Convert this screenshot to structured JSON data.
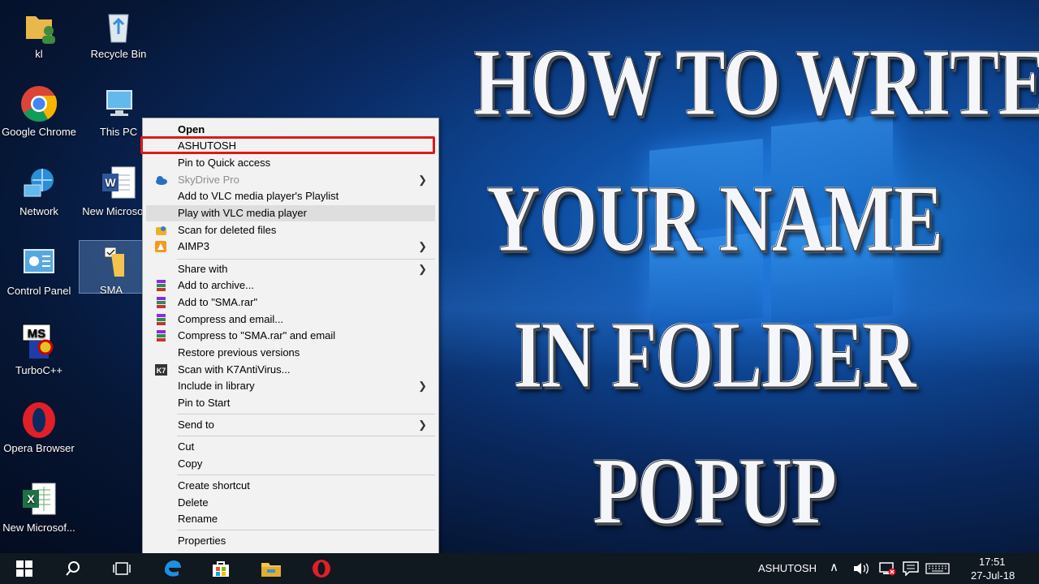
{
  "desktop": {
    "icons": [
      {
        "label": "kl",
        "icon": "user-folder-icon"
      },
      {
        "label": "Recycle Bin",
        "icon": "recycle-bin-icon"
      },
      {
        "label": "Google Chrome",
        "icon": "chrome-icon"
      },
      {
        "label": "This PC",
        "icon": "computer-icon"
      },
      {
        "label": "Network",
        "icon": "network-icon"
      },
      {
        "label": "New Microsof...",
        "icon": "word-doc-icon"
      },
      {
        "label": "Control Panel",
        "icon": "control-panel-icon"
      },
      {
        "label": "SMA",
        "icon": "folder-icon"
      },
      {
        "label": "TurboC++",
        "icon": "turboc-icon"
      },
      {
        "label": "Opera Browser",
        "icon": "opera-icon"
      },
      {
        "label": "New Microsof...",
        "icon": "excel-doc-icon"
      }
    ]
  },
  "headline": {
    "lines": [
      "HOW TO WRITE",
      "YOUR NAME",
      "IN FOLDER",
      "POPUP"
    ]
  },
  "context_menu": {
    "items": [
      {
        "label": "Open",
        "bold": true
      },
      {
        "label": "ASHUTOSH",
        "highlighted": true
      },
      {
        "label": "Pin to Quick access"
      },
      {
        "label": "SkyDrive Pro",
        "disabled": true,
        "submenu": true,
        "icon": "skydrive-icon"
      },
      {
        "label": "Add to VLC media player's Playlist"
      },
      {
        "label": "Play with VLC media player",
        "hover": true
      },
      {
        "label": "Scan for deleted files",
        "icon": "scan-icon"
      },
      {
        "label": "AIMP3",
        "submenu": true,
        "icon": "aimp-icon"
      },
      {
        "label": "Share with",
        "submenu": true
      },
      {
        "label": "Add to archive...",
        "icon": "winrar-icon"
      },
      {
        "label": "Add to \"SMA.rar\"",
        "icon": "winrar-icon"
      },
      {
        "label": "Compress and email...",
        "icon": "winrar-icon"
      },
      {
        "label": "Compress to \"SMA.rar\" and email",
        "icon": "winrar-icon"
      },
      {
        "label": "Restore previous versions"
      },
      {
        "label": "Scan with K7AntiVirus...",
        "icon": "k7-icon"
      },
      {
        "label": "Include in library",
        "submenu": true
      },
      {
        "label": "Pin to Start"
      },
      {
        "label": "Send to",
        "submenu": true
      },
      {
        "label": "Cut"
      },
      {
        "label": "Copy"
      },
      {
        "label": "Create shortcut"
      },
      {
        "label": "Delete"
      },
      {
        "label": "Rename"
      },
      {
        "label": "Properties"
      }
    ]
  },
  "taskbar": {
    "user": "ASHUTOSH",
    "time": "17:51",
    "date": "27-Jul-18",
    "apps": [
      "start-icon",
      "search-icon",
      "task-view-icon",
      "edge-icon",
      "store-icon",
      "file-explorer-icon",
      "opera-icon"
    ]
  },
  "colors": {
    "highlight_box": "#e01818",
    "menu_bg": "#f2f2f2",
    "taskbar_bg": "#101820"
  }
}
